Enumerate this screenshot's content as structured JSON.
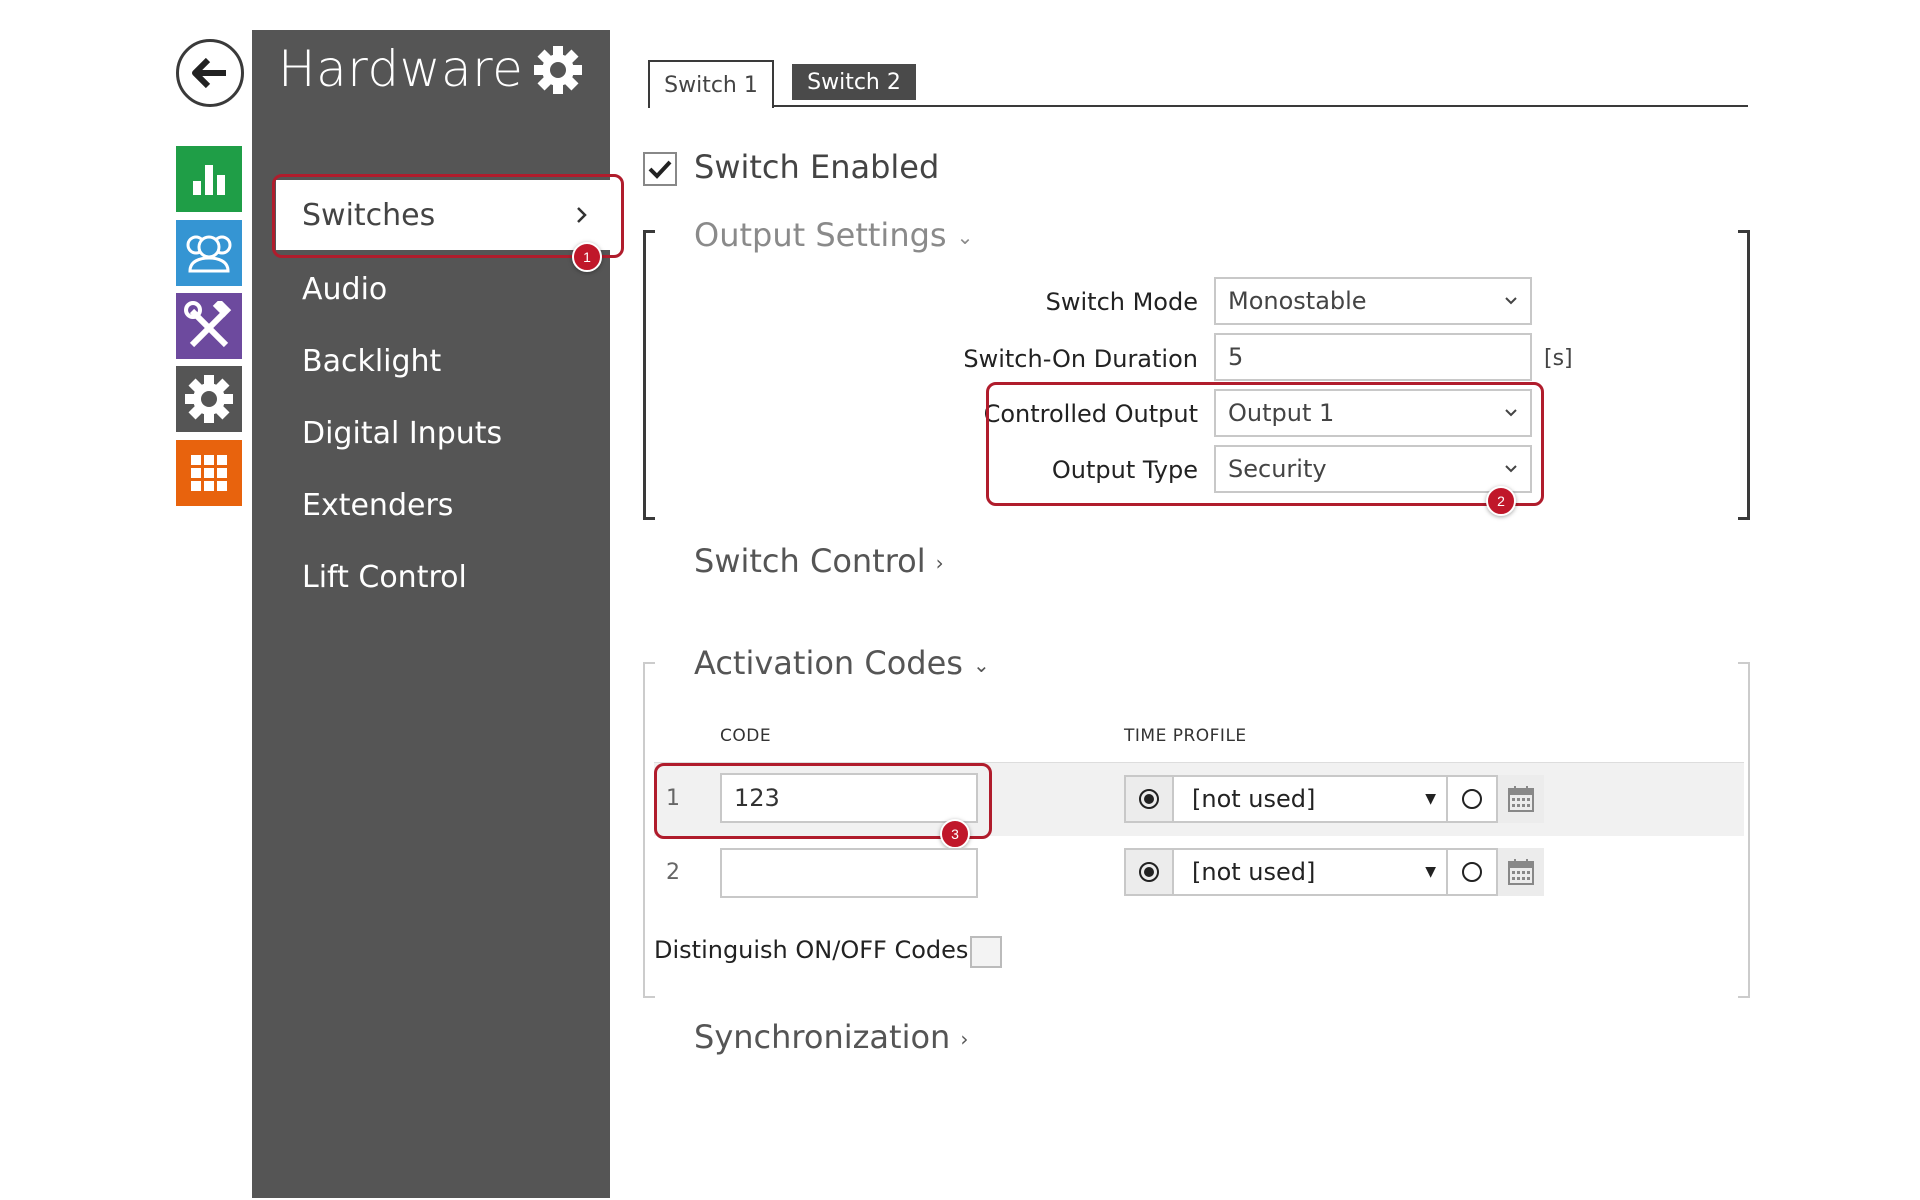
{
  "nav": {
    "back_icon": "arrow-left-icon",
    "rail": [
      {
        "name": "status",
        "icon": "bar-chart-icon",
        "color": "#1f9e47"
      },
      {
        "name": "directory",
        "icon": "users-icon",
        "color": "#3595d3"
      },
      {
        "name": "hardware",
        "icon": "tools-icon",
        "color": "#6d4a9e"
      },
      {
        "name": "services",
        "icon": "gear-icon",
        "color": "#555555"
      },
      {
        "name": "system",
        "icon": "grid-icon",
        "color": "#e8630d"
      }
    ]
  },
  "sidebar": {
    "title": "Hardware",
    "items": [
      {
        "label": "Switches",
        "active": true
      },
      {
        "label": "Audio"
      },
      {
        "label": "Backlight"
      },
      {
        "label": "Digital Inputs"
      },
      {
        "label": "Extenders"
      },
      {
        "label": "Lift Control"
      }
    ]
  },
  "tabs": [
    {
      "label": "Switch 1",
      "active": true
    },
    {
      "label": "Switch 2",
      "active": false
    }
  ],
  "switch_enabled": {
    "label": "Switch Enabled",
    "checked": true
  },
  "output_settings": {
    "heading": "Output Settings",
    "switch_mode": {
      "label": "Switch Mode",
      "value": "Monostable"
    },
    "switch_on_duration": {
      "label": "Switch-On Duration",
      "value": "5",
      "unit": "[s]"
    },
    "controlled_output": {
      "label": "Controlled Output",
      "value": "Output 1"
    },
    "output_type": {
      "label": "Output Type",
      "value": "Security"
    }
  },
  "switch_control": {
    "heading": "Switch Control"
  },
  "activation_codes": {
    "heading": "Activation Codes",
    "col_code": "CODE",
    "col_time_profile": "TIME PROFILE",
    "rows": [
      {
        "num": "1",
        "code": "123",
        "profile": "[not used]"
      },
      {
        "num": "2",
        "code": "",
        "profile": "[not used]"
      }
    ],
    "distinguish_label": "Distinguish ON/OFF Codes"
  },
  "synchronization": {
    "heading": "Synchronization"
  },
  "badges": [
    "1",
    "2",
    "3"
  ],
  "colors": {
    "highlight": "#b01c2c",
    "sidebar_bg": "#555555"
  }
}
